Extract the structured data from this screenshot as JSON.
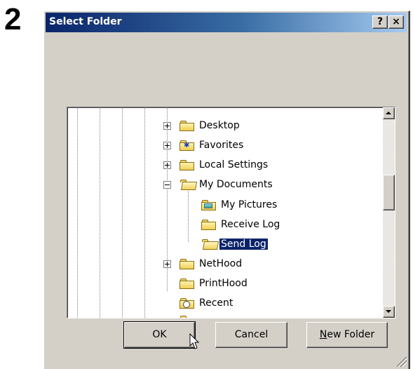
{
  "step": "2",
  "dialog": {
    "title": "Select Folder",
    "help_button": "?",
    "close_button": "×"
  },
  "tree": {
    "items": [
      {
        "label": "Desktop",
        "icon": "folder-icon",
        "expander": "plus",
        "level": 0,
        "selected": false
      },
      {
        "label": "Favorites",
        "icon": "favorites-folder-icon",
        "expander": "plus",
        "level": 0,
        "selected": false
      },
      {
        "label": "Local Settings",
        "icon": "folder-icon",
        "expander": "plus",
        "level": 0,
        "selected": false
      },
      {
        "label": "My Documents",
        "icon": "open-folder-icon",
        "expander": "minus",
        "level": 0,
        "selected": false
      },
      {
        "label": "My Pictures",
        "icon": "pictures-folder-icon",
        "expander": "none",
        "level": 1,
        "selected": false
      },
      {
        "label": "Receive Log",
        "icon": "folder-icon",
        "expander": "none",
        "level": 1,
        "selected": false
      },
      {
        "label": "Send Log",
        "icon": "open-folder-icon",
        "expander": "none",
        "level": 1,
        "selected": true
      },
      {
        "label": "NetHood",
        "icon": "folder-icon",
        "expander": "plus",
        "level": 0,
        "selected": false
      },
      {
        "label": "PrintHood",
        "icon": "folder-icon",
        "expander": "none",
        "level": 0,
        "selected": false
      },
      {
        "label": "Recent",
        "icon": "recent-folder-icon",
        "expander": "none",
        "level": 0,
        "selected": false
      }
    ]
  },
  "buttons": {
    "ok": "OK",
    "cancel": "Cancel",
    "new_folder_mnemonic": "N",
    "new_folder_rest": "ew Folder"
  }
}
